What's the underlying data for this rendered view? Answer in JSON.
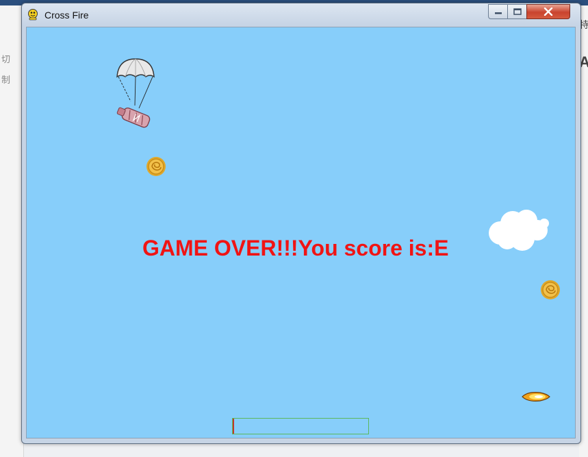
{
  "window": {
    "title": "Cross Fire",
    "controls": {
      "minimize": "minimize",
      "maximize": "maximize",
      "close": "close"
    }
  },
  "game": {
    "message": "GAME OVER!!!You score is:E",
    "message_color": "#f01414",
    "sky_color": "#87cefa",
    "health_bar": {
      "level": 0.01,
      "border_color": "#5cb85c"
    },
    "sprites": [
      "parachute-bomb-supply",
      "gold-coin",
      "gold-coin",
      "cloud",
      "fire-bullet"
    ]
  },
  "background_app": {
    "left_glyphs": [
      "切",
      "制"
    ],
    "right_glyphs": [
      "特",
      "A"
    ]
  }
}
